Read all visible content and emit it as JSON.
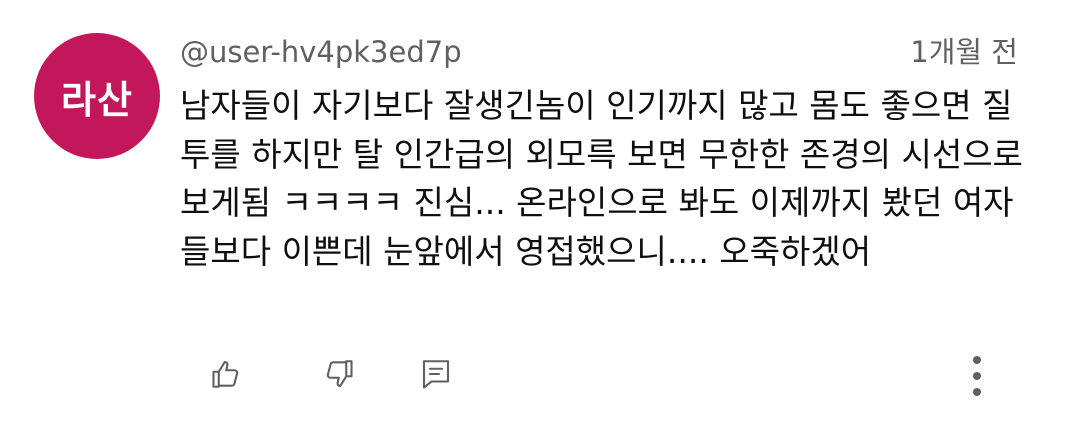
{
  "comment": {
    "avatar_text": "라산",
    "avatar_color": "#c2185b",
    "author": "@user-hv4pk3ed7p",
    "timestamp": "1개월 전",
    "text": "남자들이 자기보다 잘생긴놈이 인기까지 많고 몸도 좋으면 질투를 하지만  탈 인간급의 외모륵 보면 무한한 존경의 시선으로 보게됨 ㅋㅋㅋㅋ 진심... 온라인으로 봐도 이제까지 봤던 여자들보다 이쁜데 눈앞에서 영접했으니.... 오죽하겠어"
  },
  "actions": {
    "like_icon": "thumbs-up-icon",
    "dislike_icon": "thumbs-down-icon",
    "reply_icon": "reply-comment-icon",
    "more_icon": "more-vertical-icon"
  },
  "colors": {
    "text_primary": "#0f0f0f",
    "text_secondary": "#606060",
    "icon": "#606060"
  }
}
